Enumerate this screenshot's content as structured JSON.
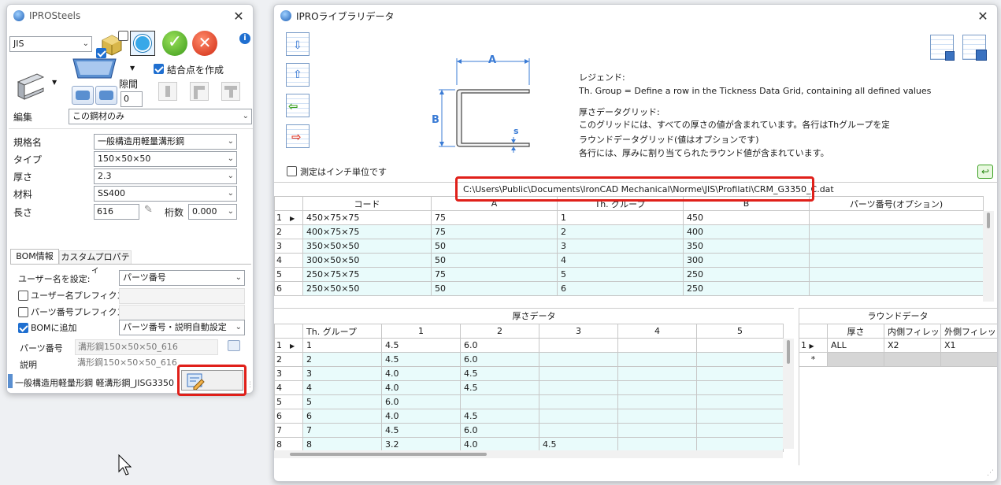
{
  "left": {
    "title": "IPROSteels",
    "standard": "JIS",
    "create_joint_label": "結合点を作成",
    "gap_label": "隙間",
    "gap_value": "0",
    "edit_label": "編集",
    "edit_value": "この鋼材のみ",
    "props": [
      {
        "label": "規格名",
        "value": "一般構造用軽量溝形鋼"
      },
      {
        "label": "タイプ",
        "value": "150×50×50"
      },
      {
        "label": "厚さ",
        "value": "2.3"
      },
      {
        "label": "材料",
        "value": "SS400"
      }
    ],
    "length_label": "長さ",
    "length_value": "616",
    "digits_label": "桁数",
    "digits_value": "0.000",
    "tabs": [
      "BOM情報",
      "カスタムプロパティ"
    ],
    "user_name_label": "ユーザー名を設定:",
    "user_name_value": "パーツ番号",
    "user_prefix_label": "ユーザー名プレフィクス",
    "part_prefix_label": "パーツ番号プレフィクス",
    "bom_add_label": "BOMに追加",
    "bom_add_value": "パーツ番号・説明自動設定",
    "part_no_label": "パーツ番号",
    "part_no_value": "溝形鋼150×50×50_616",
    "desc_label": "説明",
    "desc_value": "溝形鋼150×50×50_616",
    "status_text": "一般構造用軽量形鋼 軽溝形鋼_JISG3350"
  },
  "right": {
    "title": "IPROライブラリデータ",
    "legend_title": "レジェンド:",
    "legend_text": "Th. Group = Define a row in the Tickness Data Grid, containing all defined values",
    "thick_grid_title": "厚さデータグリッド:",
    "thick_grid_text": "このグリッドには、すべての厚さの値が含まれています。各行はThグループを定義しま",
    "round_grid_title": "ラウンドデータグリッド(値はオプションです)",
    "round_grid_text": "各行には、厚みに割り当てられたラウンド値が含まれています。",
    "inch_label": "測定はインチ単位です",
    "diagram": {
      "a": "A",
      "b": "B",
      "s": "s"
    },
    "file_path": "C:\\Users\\Public\\Documents\\IronCAD Mechanical\\Norme\\JIS\\Profilati\\CRM_G3350_C.dat",
    "main_headers": [
      "コード",
      "A",
      "Th. グループ",
      "B",
      "パーツ番号(オプション)"
    ],
    "main_rows": [
      [
        "1",
        "450×75×75",
        "75",
        "1",
        "450",
        ""
      ],
      [
        "2",
        "400×75×75",
        "75",
        "2",
        "400",
        ""
      ],
      [
        "3",
        "350×50×50",
        "50",
        "3",
        "350",
        ""
      ],
      [
        "4",
        "300×50×50",
        "50",
        "4",
        "300",
        ""
      ],
      [
        "5",
        "250×75×75",
        "75",
        "5",
        "250",
        ""
      ],
      [
        "6",
        "250×50×50",
        "50",
        "6",
        "250",
        ""
      ]
    ],
    "thick_title": "厚さデータ",
    "thick_headers": [
      "Th. グループ",
      "1",
      "2",
      "3",
      "4",
      "5"
    ],
    "thick_rows": [
      [
        "1",
        "1",
        "4.5",
        "6.0",
        "",
        "",
        ""
      ],
      [
        "2",
        "2",
        "4.5",
        "6.0",
        "",
        "",
        ""
      ],
      [
        "3",
        "3",
        "4.0",
        "4.5",
        "",
        "",
        ""
      ],
      [
        "4",
        "4",
        "4.0",
        "4.5",
        "",
        "",
        ""
      ],
      [
        "5",
        "5",
        "6.0",
        "",
        "",
        "",
        ""
      ],
      [
        "6",
        "6",
        "4.0",
        "4.5",
        "",
        "",
        ""
      ],
      [
        "7",
        "7",
        "4.5",
        "6.0",
        "",
        "",
        ""
      ],
      [
        "8",
        "8",
        "3.2",
        "4.0",
        "4.5",
        "",
        ""
      ]
    ],
    "round_title": "ラウンドデータ",
    "round_headers": [
      "厚さ",
      "内側フィレット",
      "外側フィレット"
    ],
    "round_rows": [
      [
        "1",
        "ALL",
        "X2",
        "X1"
      ]
    ],
    "new_row_marker": "*"
  }
}
